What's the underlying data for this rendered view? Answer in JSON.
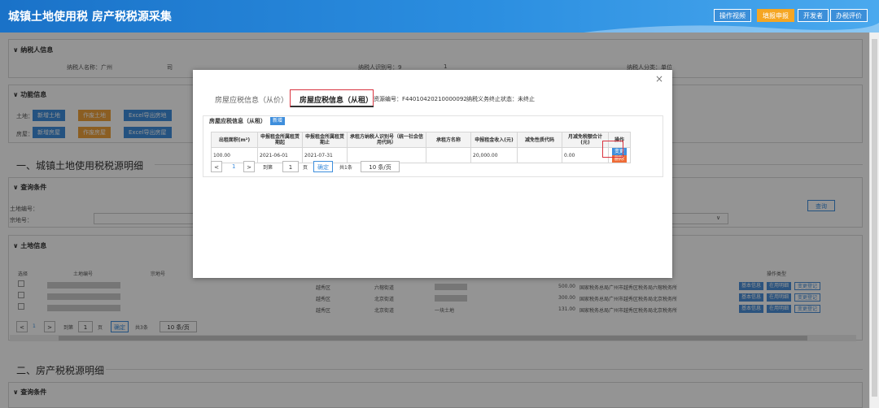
{
  "header": {
    "title": "城镇土地使用税 房产税税源采集",
    "buttons": [
      "操作视频",
      "填报申报",
      "开发者",
      "办税评价"
    ]
  },
  "taxpayer": {
    "section": "纳税人信息",
    "name_label": "纳税人名称：广州",
    "name_tail": "司",
    "id_label": "纳税人识别号：9",
    "id_tail": "1",
    "district_label": "纳税人分类：单位"
  },
  "functions": {
    "section": "功能信息",
    "land_label": "土地：",
    "house_label": "房屋：",
    "land_buttons": [
      "新增土地",
      "作废土地",
      "Excel导出房地"
    ],
    "house_buttons": [
      "新增房屋",
      "作废房屋",
      "Excel导出房屋"
    ]
  },
  "section1": {
    "title": "一、城镇土地使用税税源明细",
    "query": "查询条件",
    "land_no_label": "土地编号：",
    "land_addr_label": "宗地号：",
    "query_button": "查询",
    "land_info": "土地信息",
    "cols": [
      "选择",
      "土地编号",
      "宗地号"
    ],
    "op_col": "操作类型",
    "rows": [
      {
        "dist": "越秀区",
        "street": "六榕街道",
        "mid": "",
        "area": "500.00",
        "desc": "国家税务总局广州市越秀区税务局六榕税务所"
      },
      {
        "dist": "越秀区",
        "street": "北京街道",
        "mid": "",
        "area": "300.00",
        "desc": "国家税务总局广州市越秀区税务局北京税务所"
      },
      {
        "dist": "越秀区",
        "street": "北京街道",
        "mid": "一块土地",
        "area": "131.00",
        "desc": "国家税务总局广州市越秀区税务局北京税务所"
      }
    ],
    "row_ops": [
      "基本信息",
      "在用明细",
      "变更登记"
    ],
    "pager": {
      "prev": "<",
      "page": "1",
      "next": ">",
      "goto": "到第",
      "page_input": "1",
      "page_unit": "页",
      "confirm": "确定",
      "total": "共3条",
      "size": "10 条/页"
    }
  },
  "section2": {
    "title": "二、房产税税源明细",
    "query": "查询条件"
  },
  "modal": {
    "tab1": "房屋应税信息（从价）",
    "tab2": "房屋应税信息（从租）",
    "source_no": "资源编号：F44010420210000092",
    "status": "纳税义务终止状态：未终止",
    "panel_title": "房屋应税信息（从租）",
    "add_button": "新增",
    "close": "×",
    "table": {
      "headers": [
        "出租面积(m²)",
        "申报租金所属租赁期起",
        "申报租金所属租赁期止",
        "承租方纳税人识别号（统一社会信用代码）",
        "承租方名称",
        "申报租金收入(元)",
        "减免性质代码",
        "月减免税额合计(元)",
        "操作"
      ],
      "row": [
        "100.00",
        "2021-06-01",
        "2021-07-31",
        "",
        "",
        "20,000.00",
        "",
        "0.00"
      ],
      "ops": [
        "变更",
        "删除"
      ]
    },
    "pager": {
      "prev": "<",
      "page": "1",
      "next": ">",
      "goto": "到第",
      "page_input": "1",
      "page_unit": "页",
      "confirm": "确定",
      "total": "共1条",
      "size": "10 条/页"
    }
  }
}
